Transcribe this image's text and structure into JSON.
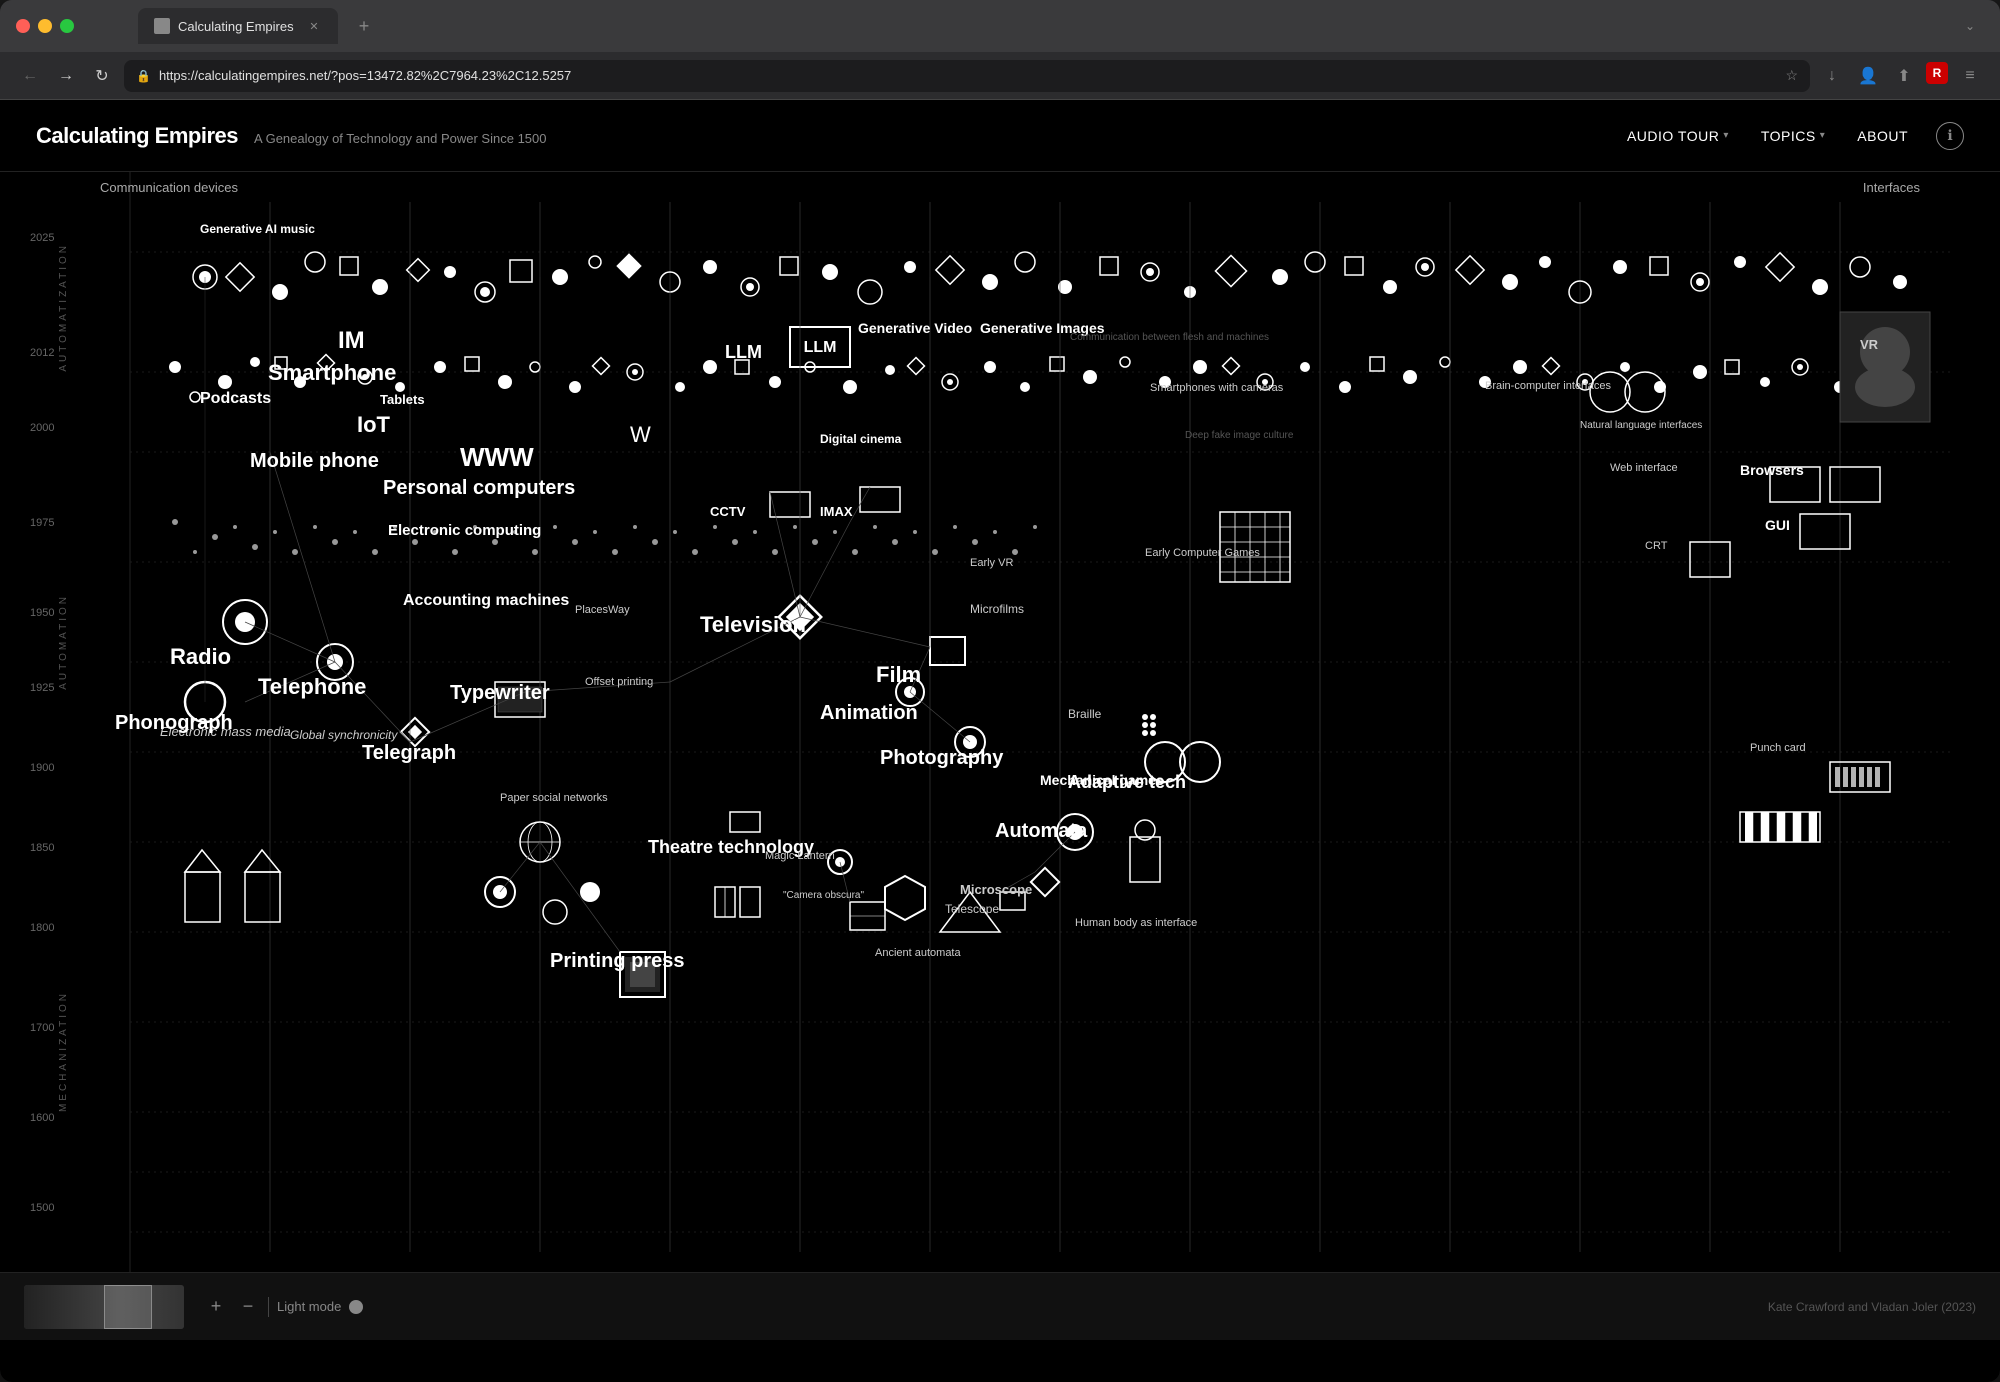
{
  "browser": {
    "traffic_lights": [
      "red",
      "yellow",
      "green"
    ],
    "tab": {
      "title": "Calculating Empires",
      "favicon": "CE"
    },
    "url": "https://calculatingempires.net/?pos=13472.82%2C7964.23%2C12.5257",
    "new_tab_icon": "+"
  },
  "nav": {
    "back_icon": "←",
    "forward_icon": "→",
    "reload_icon": "↻",
    "lock_icon": "🔒",
    "star_icon": "☆",
    "download_icon": "↓",
    "account_icon": "👤",
    "share_icon": "⬆",
    "extensions_icon": "R",
    "menu_icon": "≡"
  },
  "site": {
    "title": "Calculating Empires",
    "subtitle": "A Genealogy of Technology and Power Since 1500",
    "nav_items": [
      {
        "label": "AUDIO TOUR",
        "has_dropdown": true
      },
      {
        "label": "TOPICS",
        "has_dropdown": true
      },
      {
        "label": "ABOUT",
        "has_dropdown": false
      }
    ],
    "info_label": "ℹ"
  },
  "visualization": {
    "section_labels_top": [
      "Communication devices",
      "Interfaces"
    ],
    "era_labels": [
      "Automatization",
      "Automation",
      "Mechanization"
    ],
    "years": [
      "2025",
      "2012",
      "2000",
      "1975",
      "1950",
      "1925",
      "1900",
      "1850",
      "1800",
      "1700",
      "1600",
      "1500"
    ],
    "major_nodes": [
      {
        "label": "Smartphone",
        "size": "xl"
      },
      {
        "label": "Mobile phone",
        "size": "xl"
      },
      {
        "label": "Personal computers",
        "size": "xl"
      },
      {
        "label": "WWW",
        "size": "xl"
      },
      {
        "label": "IoT",
        "size": "xl"
      },
      {
        "label": "Podcasts",
        "size": "lg"
      },
      {
        "label": "Radio",
        "size": "xl"
      },
      {
        "label": "Telephone",
        "size": "xl"
      },
      {
        "label": "Phonograph",
        "size": "xl"
      },
      {
        "label": "Telegraph",
        "size": "xl"
      },
      {
        "label": "Typewriter",
        "size": "xl"
      },
      {
        "label": "Television",
        "size": "xl"
      },
      {
        "label": "Film",
        "size": "xl"
      },
      {
        "label": "Animation",
        "size": "xl"
      },
      {
        "label": "Photography",
        "size": "xl"
      },
      {
        "label": "Printing press",
        "size": "xl"
      },
      {
        "label": "Theatre technology",
        "size": "xl"
      },
      {
        "label": "Automata",
        "size": "xl"
      },
      {
        "label": "Accounting machines",
        "size": "lg"
      },
      {
        "label": "Electronic computing",
        "size": "lg"
      },
      {
        "label": "Electronic mass media",
        "size": "lg"
      },
      {
        "label": "Generative AI music",
        "size": "lg"
      },
      {
        "label": "LLM",
        "size": "lg"
      },
      {
        "label": "Generative Video",
        "size": "lg"
      },
      {
        "label": "Generative Images",
        "size": "lg"
      },
      {
        "label": "Microfilms",
        "size": "md"
      },
      {
        "label": "CCTV",
        "size": "md"
      },
      {
        "label": "IMAX",
        "size": "md"
      },
      {
        "label": "Digital cinema",
        "size": "md"
      },
      {
        "label": "Microscope",
        "size": "md"
      },
      {
        "label": "Telescope",
        "size": "md"
      },
      {
        "label": "Adaptive tech",
        "size": "lg"
      },
      {
        "label": "Mechanical games",
        "size": "md"
      },
      {
        "label": "Braille",
        "size": "sm"
      },
      {
        "label": "Browsers",
        "size": "md"
      },
      {
        "label": "GUI",
        "size": "md"
      },
      {
        "label": "Global synchronicity",
        "size": "sm"
      },
      {
        "label": "PlacesWay",
        "size": "sm"
      }
    ]
  },
  "bottom_bar": {
    "zoom_in": "+",
    "zoom_out": "−",
    "divider": "|",
    "mode_label": "Light mode",
    "credit": "Kate Crawford and Vladan Joler (2023)"
  }
}
